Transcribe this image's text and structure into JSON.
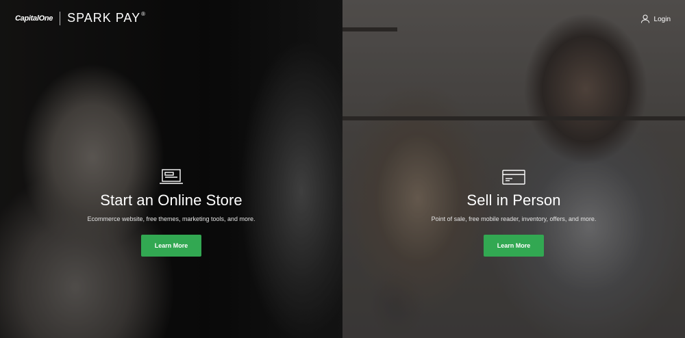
{
  "header": {
    "capital_one": "CapitalOne",
    "product": "SPARK PAY",
    "registered": "®",
    "login_label": "Login"
  },
  "panels": [
    {
      "icon": "laptop-icon",
      "title": "Start an Online Store",
      "subtitle": "Ecommerce website, free themes, marketing tools, and more.",
      "button": "Learn More"
    },
    {
      "icon": "credit-card-icon",
      "title": "Sell in Person",
      "subtitle": "Point of sale, free mobile reader, inventory, offers, and more.",
      "button": "Learn More"
    }
  ],
  "colors": {
    "button": "#32a852",
    "text": "#ffffff"
  }
}
